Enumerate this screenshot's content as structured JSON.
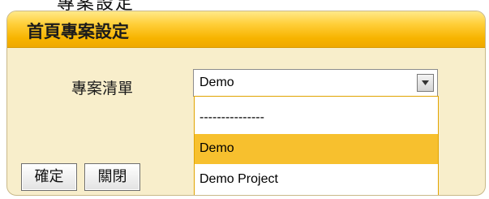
{
  "page": {
    "top_text": "專案設定"
  },
  "dialog": {
    "title": "首頁專案設定",
    "field_label": "專案清單",
    "select": {
      "value": "Demo",
      "options": [
        "---------------",
        "Demo",
        "Demo Project"
      ],
      "selected_index": 1
    },
    "buttons": {
      "ok": "確定",
      "close": "關閉"
    }
  },
  "colors": {
    "header_accent": "#f7b400",
    "panel_bg": "#f8eecb",
    "selected_option": "#f7c02e"
  }
}
